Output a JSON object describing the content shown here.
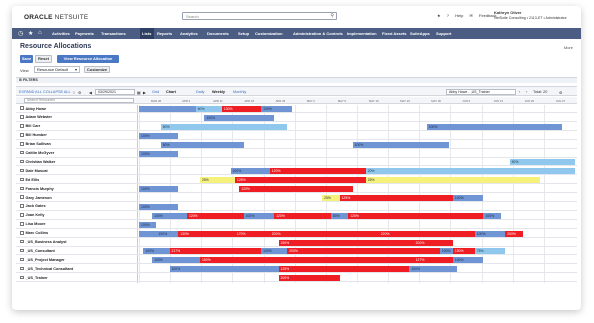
{
  "app": {
    "logo_bold": "ORACLE",
    "logo_brand": "NETSUITE",
    "search_placeholder": "Search",
    "icons": [
      "help-icon",
      "feedback-icon"
    ],
    "help_label": "Help",
    "feedback_label": "Feedback",
    "user_name": "Kathryn Oliver",
    "user_role": "NetSuite Consulting • 2113-ET • Administrator"
  },
  "nav": {
    "items": [
      "Activities",
      "Payments",
      "Transactions",
      "Lists",
      "Reports",
      "Analytics",
      "Documents",
      "Setup",
      "Customization",
      "Administration & Controls",
      "Implementation",
      "Fixed Assets",
      "SuiteApps",
      "Support"
    ],
    "active": "Lists"
  },
  "page": {
    "title": "Resource Allocations",
    "more": "More",
    "save": "Save",
    "reset": "Reset",
    "view_new": "View Resource Allocation",
    "filter_label": "View",
    "filter_value": "Resource Default",
    "customize": "Customize",
    "filters_label": "FILTERS"
  },
  "toolbar": {
    "expand_all": "EXPAND ALL",
    "collapse_all": "COLLAPSE ALL",
    "date": "03/29/2021",
    "views": [
      "Grid",
      "Chart"
    ],
    "active_view": "Chart",
    "scales": [
      "Daily",
      "Weekly",
      "Monthly"
    ],
    "active_scale": "Weekly",
    "resource": "Abby Howe - ,US_Trainer",
    "total": "Total: 20"
  },
  "header": {
    "search_placeholder": "Search Resources",
    "dates": [
      "MAR 28",
      "APR 4",
      "APR 11",
      "APR 18",
      "APR 25",
      "MAY 2",
      "MAY 9",
      "MAY 16",
      "MAY 23",
      "MAY 30",
      "JUN 6",
      "JUN 13",
      "JUN 20",
      "JUN 27"
    ]
  },
  "rows": [
    {
      "name": "Abby Howe",
      "bars": [
        {
          "s": 0,
          "e": 0.13,
          "c": "blue",
          "t": ""
        },
        {
          "s": 0.13,
          "e": 0.19,
          "c": "light",
          "t": "50%"
        },
        {
          "s": 0.19,
          "e": 0.28,
          "c": "red",
          "t": "130%"
        },
        {
          "s": 0.28,
          "e": 0.35,
          "c": "blue",
          "t": "100%"
        }
      ]
    },
    {
      "name": "Adam Webster",
      "bars": [
        {
          "s": 0.15,
          "e": 0.31,
          "c": "blue",
          "t": "100%"
        }
      ]
    },
    {
      "name": "Bill Carr",
      "bars": [
        {
          "s": 0.05,
          "e": 0.34,
          "c": "light",
          "t": "50%"
        },
        {
          "s": 0.66,
          "e": 0.97,
          "c": "blue",
          "t": "100%"
        }
      ]
    },
    {
      "name": "Bill Humber",
      "bars": [
        {
          "s": 0,
          "e": 0.09,
          "c": "blue",
          "t": "100%"
        }
      ]
    },
    {
      "name": "Brian Sullivan",
      "bars": [
        {
          "s": 0.05,
          "e": 0.24,
          "c": "blue",
          "t": "80%"
        },
        {
          "s": 0.49,
          "e": 0.71,
          "c": "blue",
          "t": "100%"
        }
      ]
    },
    {
      "name": "Caitlin McGyver",
      "bars": [
        {
          "s": 0,
          "e": 0.09,
          "c": "blue",
          "t": "100%"
        }
      ]
    },
    {
      "name": "Christian Walker",
      "bars": [
        {
          "s": 0.85,
          "e": 1.0,
          "c": "light",
          "t": "50%"
        }
      ]
    },
    {
      "name": "Dale Muscat",
      "bars": [
        {
          "s": 0.21,
          "e": 0.3,
          "c": "blue",
          "t": "100%"
        },
        {
          "s": 0.3,
          "e": 0.52,
          "c": "red",
          "t": "120%"
        },
        {
          "s": 0.52,
          "e": 1.0,
          "c": "light",
          "t": "20%"
        }
      ]
    },
    {
      "name": "Ed Ellis",
      "bars": [
        {
          "s": 0.14,
          "e": 0.22,
          "c": "yellow",
          "t": "25%"
        },
        {
          "s": 0.22,
          "e": 0.52,
          "c": "red",
          "t": "125%"
        },
        {
          "s": 0.52,
          "e": 0.92,
          "c": "yellow",
          "t": "25%"
        }
      ]
    },
    {
      "name": "Francis Murphy",
      "bars": [
        {
          "s": 0,
          "e": 0.09,
          "c": "blue",
          "t": "100%"
        },
        {
          "s": 0.23,
          "e": 0.49,
          "c": "red",
          "t": "120%"
        }
      ]
    },
    {
      "name": "Gary Jameson",
      "bars": [
        {
          "s": 0.42,
          "e": 0.46,
          "c": "yellow",
          "t": "25%"
        },
        {
          "s": 0.46,
          "e": 0.72,
          "c": "red",
          "t": "125%"
        },
        {
          "s": 0.72,
          "e": 0.79,
          "c": "blue",
          "t": "100%"
        }
      ]
    },
    {
      "name": "Jack Gates",
      "bars": [
        {
          "s": 0,
          "e": 0.09,
          "c": "blue",
          "t": "100%"
        }
      ]
    },
    {
      "name": "Joan Kelly",
      "bars": [
        {
          "s": 0.03,
          "e": 0.11,
          "c": "blue",
          "t": "100%"
        },
        {
          "s": 0.11,
          "e": 0.24,
          "c": "red",
          "t": "120%"
        },
        {
          "s": 0.24,
          "e": 0.31,
          "c": "blue",
          "t": "100%"
        },
        {
          "s": 0.31,
          "e": 0.44,
          "c": "red",
          "t": "120%"
        },
        {
          "s": 0.44,
          "e": 0.48,
          "c": "blue",
          "t": "80%"
        },
        {
          "s": 0.48,
          "e": 0.79,
          "c": "red",
          "t": "120%"
        },
        {
          "s": 0.79,
          "e": 0.83,
          "c": "blue",
          "t": "100%"
        }
      ]
    },
    {
      "name": "Lisa Moore",
      "bars": [
        {
          "s": 0,
          "e": 0.04,
          "c": "blue",
          "t": "100%"
        }
      ]
    },
    {
      "name": "Marc Collins",
      "bars": [
        {
          "s": 0,
          "e": 0.04,
          "c": "blue",
          "t": ""
        },
        {
          "s": 0.04,
          "e": 0.09,
          "c": "blue",
          "t": "100%"
        },
        {
          "s": 0.09,
          "e": 0.22,
          "c": "red",
          "t": "130%"
        },
        {
          "s": 0.22,
          "e": 0.3,
          "c": "red",
          "t": "170%"
        },
        {
          "s": 0.3,
          "e": 0.55,
          "c": "red",
          "t": "200%"
        },
        {
          "s": 0.55,
          "e": 0.77,
          "c": "red",
          "t": "220%"
        },
        {
          "s": 0.77,
          "e": 0.84,
          "c": "blue",
          "t": "100%"
        },
        {
          "s": 0.84,
          "e": 0.88,
          "c": "red",
          "t": "200%"
        }
      ]
    },
    {
      "name": "_US_Business Analyst",
      "bars": [
        {
          "s": 0.32,
          "e": 0.63,
          "c": "red",
          "t": "150%"
        },
        {
          "s": 0.63,
          "e": 0.72,
          "c": "red",
          "t": "200%"
        }
      ]
    },
    {
      "name": "_US_Consultant",
      "bars": [
        {
          "s": 0.01,
          "e": 0.07,
          "c": "blue",
          "t": "100%"
        },
        {
          "s": 0.07,
          "e": 0.28,
          "c": "red",
          "t": "217%"
        },
        {
          "s": 0.28,
          "e": 0.34,
          "c": "blue",
          "t": "100%"
        },
        {
          "s": 0.34,
          "e": 0.69,
          "c": "red",
          "t": "200%"
        },
        {
          "s": 0.69,
          "e": 0.72,
          "c": "blue",
          "t": "100%"
        },
        {
          "s": 0.72,
          "e": 0.77,
          "c": "red",
          "t": "150%"
        },
        {
          "s": 0.77,
          "e": 0.84,
          "c": "light",
          "t": "75%"
        }
      ]
    },
    {
      "name": "_US_Project Manager",
      "bars": [
        {
          "s": 0.03,
          "e": 0.14,
          "c": "blue",
          "t": "100%"
        },
        {
          "s": 0.14,
          "e": 0.63,
          "c": "red",
          "t": "150%"
        },
        {
          "s": 0.63,
          "e": 0.72,
          "c": "red",
          "t": "127%"
        },
        {
          "s": 0.72,
          "e": 0.79,
          "c": "blue",
          "t": "100%"
        }
      ]
    },
    {
      "name": "_US_Technical Consultant",
      "bars": [
        {
          "s": 0.07,
          "e": 0.32,
          "c": "blue",
          "t": "100%"
        },
        {
          "s": 0.32,
          "e": 0.62,
          "c": "red",
          "t": "125%"
        },
        {
          "s": 0.62,
          "e": 0.73,
          "c": "blue",
          "t": "100%"
        }
      ]
    },
    {
      "name": "_US_Trainer",
      "bars": [
        {
          "s": 0.32,
          "e": 0.46,
          "c": "red",
          "t": "200%"
        }
      ]
    }
  ]
}
